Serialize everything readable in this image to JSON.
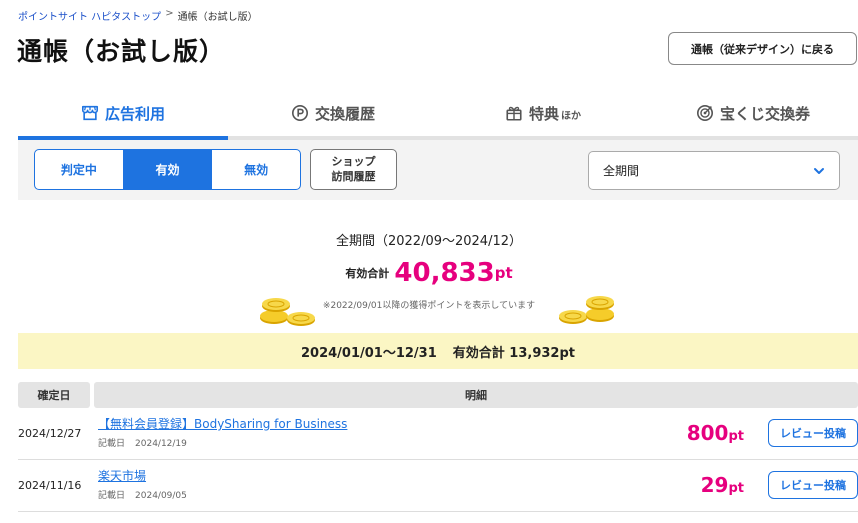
{
  "breadcrumb": {
    "home": "ポイントサイト ハピタストップ",
    "sep": ">",
    "current": "通帳（お試し版）"
  },
  "page_title": "通帳（お試し版）",
  "top_button": "通帳（従来デザイン）に戻る",
  "tabs": [
    {
      "label": "広告利用",
      "icon": "shop-icon",
      "active": true
    },
    {
      "label": "交換履歴",
      "icon": "point-exchange-icon",
      "active": false
    },
    {
      "label": "特典",
      "small": "ほか",
      "icon": "gift-box-icon",
      "active": false
    },
    {
      "label": "宝くじ交換券",
      "icon": "target-icon",
      "active": false
    }
  ],
  "filters": {
    "segments": [
      {
        "label": "判定中",
        "active": false
      },
      {
        "label": "有効",
        "active": true
      },
      {
        "label": "無効",
        "active": false
      }
    ],
    "shop_button": {
      "line1": "ショップ",
      "line2": "訪問履歴"
    },
    "period_select": "全期間"
  },
  "summary": {
    "period": "全期間（2022/09〜2024/12）",
    "total_label": "有効合計",
    "total_value": "40,833",
    "total_unit": "pt",
    "note": "※2022/09/01以降の獲得ポイントを表示しています"
  },
  "year_bar": {
    "range": "2024/01/01〜12/31",
    "total": "有効合計 13,932pt"
  },
  "table": {
    "headers": {
      "date": "確定日",
      "detail": "明細"
    },
    "rows": [
      {
        "date": "2024/12/27",
        "name": "【無料会員登録】BodySharing for Business",
        "rec_label": "記載日",
        "rec_date": "2024/12/19",
        "points": "800",
        "unit": "pt",
        "review": "レビュー投稿"
      },
      {
        "date": "2024/11/16",
        "name": "楽天市場",
        "rec_label": "記載日",
        "rec_date": "2024/09/05",
        "points": "29",
        "unit": "pt",
        "review": "レビュー投稿"
      }
    ]
  },
  "colors": {
    "accent": "#1e73e0",
    "points": "#e6007e",
    "year_bar": "#fbf6c4"
  }
}
